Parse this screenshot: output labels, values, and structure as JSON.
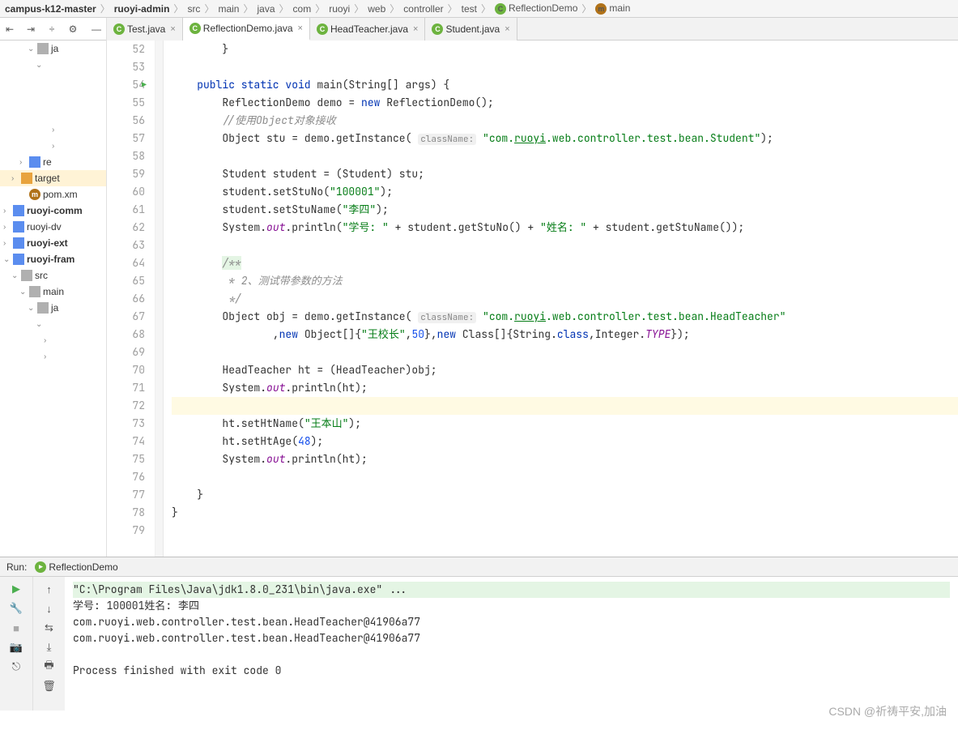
{
  "breadcrumb": [
    "campus-k12-master",
    "ruoyi-admin",
    "src",
    "main",
    "java",
    "com",
    "ruoyi",
    "web",
    "controller",
    "test",
    "ReflectionDemo",
    "main"
  ],
  "breadcrumb_bold": [
    0,
    1
  ],
  "breadcrumb_c_icon": 10,
  "breadcrumb_m_icon": 11,
  "tabs": [
    {
      "label": "Test.java",
      "active": false
    },
    {
      "label": "ReflectionDemo.java",
      "active": true
    },
    {
      "label": "HeadTeacher.java",
      "active": false
    },
    {
      "label": "Student.java",
      "active": false
    }
  ],
  "tree": [
    {
      "indent": 3,
      "arrow": "v",
      "icon": "gray",
      "label": "ja"
    },
    {
      "indent": 4,
      "arrow": "v",
      "icon": "",
      "label": ""
    },
    {
      "indent": 0,
      "arrow": "",
      "icon": "",
      "label": ""
    },
    {
      "indent": 0,
      "arrow": "",
      "icon": "",
      "label": ""
    },
    {
      "indent": 0,
      "arrow": "",
      "icon": "",
      "label": ""
    },
    {
      "indent": 6,
      "arrow": ">",
      "icon": "",
      "label": ""
    },
    {
      "indent": 6,
      "arrow": ">",
      "icon": "",
      "label": ""
    },
    {
      "indent": 2,
      "arrow": ">",
      "icon": "blue",
      "label": "re"
    },
    {
      "indent": 1,
      "arrow": ">",
      "icon": "orange",
      "label": "target",
      "hl": true
    },
    {
      "indent": 2,
      "arrow": "",
      "icon": "m",
      "label": "pom.xm"
    },
    {
      "indent": 0,
      "arrow": ">",
      "icon": "blue",
      "label": "ruoyi-comm",
      "bold": true
    },
    {
      "indent": 0,
      "arrow": ">",
      "icon": "blue",
      "label": "ruoyi-dv"
    },
    {
      "indent": 0,
      "arrow": ">",
      "icon": "blue",
      "label": "ruoyi-ext",
      "bold": true
    },
    {
      "indent": 0,
      "arrow": "v",
      "icon": "blue",
      "label": "ruoyi-fram",
      "bold": true
    },
    {
      "indent": 1,
      "arrow": "v",
      "icon": "gray",
      "label": "src"
    },
    {
      "indent": 2,
      "arrow": "v",
      "icon": "gray",
      "label": "main"
    },
    {
      "indent": 3,
      "arrow": "v",
      "icon": "gray",
      "label": "ja"
    },
    {
      "indent": 4,
      "arrow": "v",
      "icon": "",
      "label": ""
    },
    {
      "indent": 5,
      "arrow": ">",
      "icon": "",
      "label": ""
    },
    {
      "indent": 5,
      "arrow": ">",
      "icon": "",
      "label": ""
    }
  ],
  "code_start_line": 52,
  "run_marker_line": 54,
  "code_lines": [
    {
      "n": 52,
      "html": "        }"
    },
    {
      "n": 53,
      "html": ""
    },
    {
      "n": 54,
      "html": "    <span class='kw'>public static void</span> <span class='fn'>main</span>(String[] args) {"
    },
    {
      "n": 55,
      "html": "        ReflectionDemo demo = <span class='kw'>new</span> ReflectionDemo();"
    },
    {
      "n": 56,
      "html": "        <span class='cmt'>//使用Object对象接收</span>"
    },
    {
      "n": 57,
      "html": "        Object stu = demo.getInstance( <span class='hint'>className:</span> <span class='str'>\"com.<u>ruoyi</u>.web.controller.test.bean.Student\"</span>);"
    },
    {
      "n": 58,
      "html": ""
    },
    {
      "n": 59,
      "html": "        Student student = (Student) stu;"
    },
    {
      "n": 60,
      "html": "        student.setStuNo(<span class='str'>\"100001\"</span>);"
    },
    {
      "n": 61,
      "html": "        student.setStuName(<span class='str'>\"李四\"</span>);"
    },
    {
      "n": 62,
      "html": "        System.<span class='fld'>out</span>.println(<span class='str'>\"学号: \"</span> + student.getStuNo() + <span class='str'>\"姓名: \"</span> + student.getStuName());"
    },
    {
      "n": 63,
      "html": ""
    },
    {
      "n": 64,
      "html": "        <span class='doc doc-bg'>/**</span>"
    },
    {
      "n": 65,
      "html": "<span class='doc'>         * 2、测试带参数的方法</span>"
    },
    {
      "n": 66,
      "html": "<span class='doc'>         */</span>"
    },
    {
      "n": 67,
      "html": "        Object obj = demo.getInstance( <span class='hint'>className:</span> <span class='str'>\"com.<u>ruoyi</u>.web.controller.test.bean.HeadTeacher\"</span>"
    },
    {
      "n": 68,
      "html": "                ,<span class='kw'>new</span> Object[]{<span class='str'>\"王校长\"</span>,<span class='num'>50</span>},<span class='kw'>new</span> Class[]{String.<span class='kw'>class</span>,Integer.<span class='fld'>TYPE</span>});"
    },
    {
      "n": 69,
      "html": ""
    },
    {
      "n": 70,
      "html": "        HeadTeacher ht = (HeadTeacher)obj;"
    },
    {
      "n": 71,
      "html": "        System.<span class='fld'>out</span>.println(ht);"
    },
    {
      "n": 72,
      "html": "",
      "caret": true
    },
    {
      "n": 73,
      "html": "        ht.setHtName(<span class='str'>\"王本山\"</span>);"
    },
    {
      "n": 74,
      "html": "        ht.setHtAge(<span class='num'>48</span>);"
    },
    {
      "n": 75,
      "html": "        System.<span class='fld'>out</span>.println(ht);"
    },
    {
      "n": 76,
      "html": ""
    },
    {
      "n": 77,
      "html": "    }"
    },
    {
      "n": 78,
      "html": "}"
    },
    {
      "n": 79,
      "html": ""
    }
  ],
  "run": {
    "label": "Run:",
    "config": "ReflectionDemo",
    "lines": [
      {
        "text": "\"C:\\Program Files\\Java\\jdk1.8.0_231\\bin\\java.exe\" ...",
        "hl": true
      },
      {
        "text": "学号: 100001姓名: 李四"
      },
      {
        "text": "com.ruoyi.web.controller.test.bean.HeadTeacher@41906a77"
      },
      {
        "text": "com.ruoyi.web.controller.test.bean.HeadTeacher@41906a77"
      },
      {
        "text": ""
      },
      {
        "text": "Process finished with exit code 0"
      }
    ]
  },
  "watermark": "CSDN @祈祷平安,加油"
}
